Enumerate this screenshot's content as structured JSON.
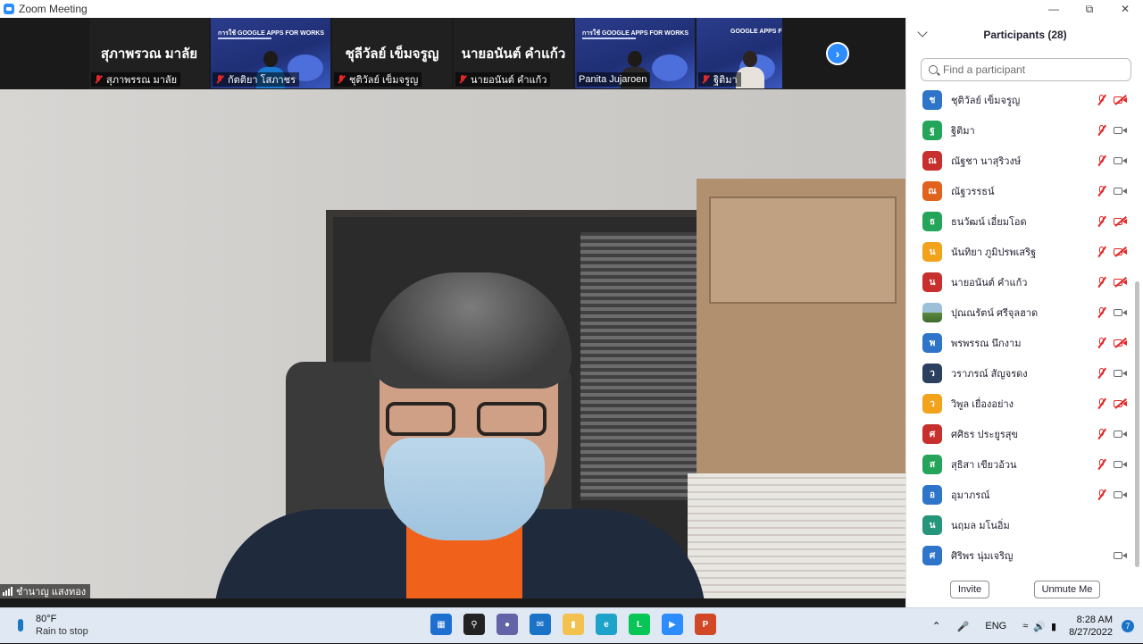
{
  "window": {
    "title": "Zoom Meeting"
  },
  "thumbnails": [
    {
      "name_tag": "สุภาพรรณ มาลัย",
      "big_name": "สุภาพรวณ มาลัย",
      "kind": "name"
    },
    {
      "name_tag": "กัตติยา โสภาชร",
      "kind": "slide",
      "slide_title": "การใช้ GOOGLE APPS FOR WORKS"
    },
    {
      "name_tag": "ชุติวัลย์ เข็มจรูญ",
      "big_name": "ชุลีวัลย์ เข็มจรูญ",
      "kind": "name"
    },
    {
      "name_tag": "นายอนันต์ คำแก้ว",
      "big_name": "นายอนันต์ คำแก้ว",
      "kind": "name"
    },
    {
      "name_tag": "Panita Jujaroen",
      "kind": "slide",
      "slide_title": "การใช้ GOOGLE APPS FOR WORKS"
    },
    {
      "name_tag": "ฐิติมา",
      "kind": "slide",
      "slide_title": "GOOGLE APPS FO"
    }
  ],
  "main_speaker": {
    "name": "ชำนาญ แสงทอง"
  },
  "participants_panel": {
    "title": "Participants (28)",
    "search_placeholder": "Find a participant",
    "invite_label": "Invite",
    "unmute_label": "Unmute Me",
    "participants": [
      {
        "initial": "ช",
        "name": "ชุติวัลย์ เข็มจรูญ",
        "color": "#2e74c9",
        "mic_muted": true,
        "video_off": true
      },
      {
        "initial": "ฐ",
        "name": "ฐิติมา",
        "color": "#25a55a",
        "mic_muted": true,
        "video_off": false
      },
      {
        "initial": "ณ",
        "name": "ณัฐชา นาสุริวงษ์",
        "color": "#c8302e",
        "mic_muted": true,
        "video_off": false
      },
      {
        "initial": "ณ",
        "name": "ณัฐวรรธน์",
        "color": "#e0621c",
        "mic_muted": true,
        "video_off": false
      },
      {
        "initial": "ธ",
        "name": "ธนวัฒน์ เอี่ยมโอด",
        "color": "#25a55a",
        "mic_muted": true,
        "video_off": true
      },
      {
        "initial": "น",
        "name": "นันทิยา ภูมิปรพเสริฐ",
        "color": "#f2a21b",
        "mic_muted": true,
        "video_off": true
      },
      {
        "initial": "น",
        "name": "นายอนันต์ คำแก้ว",
        "color": "#c8302e",
        "mic_muted": true,
        "video_off": true
      },
      {
        "initial": "",
        "name": "ปุณณรัตน์ ศรีจุลฮาด",
        "color": "#5b8a3e",
        "photo": true,
        "mic_muted": true,
        "video_off": false
      },
      {
        "initial": "พ",
        "name": "พรพรรณ นึกงาม",
        "color": "#2e74c9",
        "mic_muted": true,
        "video_off": true
      },
      {
        "initial": "ว",
        "name": "วราภรณ์ สัญจรดง",
        "color": "#2b3f5e",
        "mic_muted": true,
        "video_off": false
      },
      {
        "initial": "ว",
        "name": "วิพูล เยื่องอย่าง",
        "color": "#f2a21b",
        "mic_muted": true,
        "video_off": true
      },
      {
        "initial": "ศ",
        "name": "ศศิธร ประยูรสุข",
        "color": "#c8302e",
        "mic_muted": true,
        "video_off": false
      },
      {
        "initial": "ส",
        "name": "สุธิสา เขียวอ้วน",
        "color": "#25a55a",
        "mic_muted": true,
        "video_off": false
      },
      {
        "initial": "อ",
        "name": "อุมาภรณ์",
        "color": "#2e74c9",
        "mic_muted": true,
        "video_off": false
      },
      {
        "initial": "น",
        "name": "นฤมล มโนอิ่ม",
        "color": "#25967a",
        "mic_muted": false,
        "video_off": null
      },
      {
        "initial": "ศ",
        "name": "ศิริพร นุ่มเจริญ",
        "color": "#2e74c9",
        "mic_muted": false,
        "video_off": false
      }
    ]
  },
  "taskbar": {
    "weather_temp": "80°F",
    "weather_text": "Rain to stop",
    "language": "ENG",
    "time": "8:28 AM",
    "date": "8/27/2022",
    "notification_count": "7",
    "apps": [
      {
        "icon": "windows-start-icon",
        "color": "#1f6fd0"
      },
      {
        "icon": "search-icon",
        "color": "#222222"
      },
      {
        "icon": "teams-chat-icon",
        "color": "#6264a7"
      },
      {
        "icon": "mail-icon",
        "color": "#1a73c7"
      },
      {
        "icon": "file-explorer-icon",
        "color": "#f2c14e"
      },
      {
        "icon": "edge-icon",
        "color": "#1da2c9"
      },
      {
        "icon": "line-icon",
        "color": "#06c755"
      },
      {
        "icon": "zoom-icon",
        "color": "#2d8cff"
      },
      {
        "icon": "powerpoint-icon",
        "color": "#d24726"
      }
    ]
  }
}
